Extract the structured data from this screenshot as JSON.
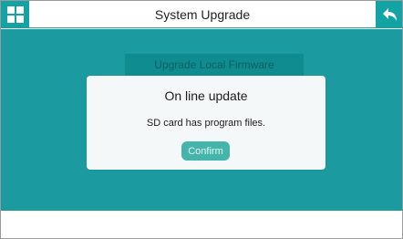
{
  "header": {
    "title": "System Upgrade",
    "home_icon": "grid-menu-icon",
    "back_icon": "back-arrow-icon"
  },
  "background": {
    "menu_item_label": "Upgrade Local Firmware"
  },
  "dialog": {
    "title": "On line update",
    "message": "SD card has program files.",
    "confirm_label": "Confirm"
  },
  "colors": {
    "accent": "#12a3a4",
    "content_bg": "#1b9ba0",
    "button": "#45b5ac",
    "dialog_bg": "#f5f8f8"
  }
}
